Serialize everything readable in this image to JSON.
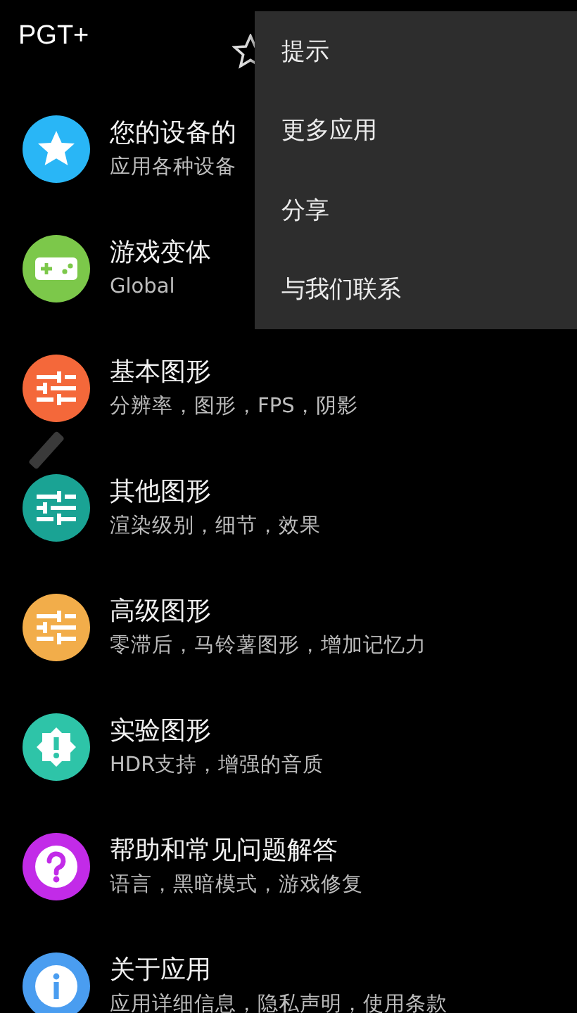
{
  "app_bar": {
    "title": "PGT+"
  },
  "items": [
    {
      "kind": "star",
      "color": "#29b6f6",
      "title": "您的设备的",
      "subtitle": "应用各种设备"
    },
    {
      "kind": "gamepad",
      "color": "#7cc84a",
      "title": "游戏变体",
      "subtitle": "Global"
    },
    {
      "kind": "sliders",
      "color": "#f4683a",
      "title": "基本图形",
      "subtitle": "分辨率，图形，FPS，阴影"
    },
    {
      "kind": "sliders",
      "color": "#1aa394",
      "title": "其他图形",
      "subtitle": "渲染级别，细节，效果"
    },
    {
      "kind": "sliders",
      "color": "#f2ad4a",
      "title": "高级图形",
      "subtitle": "零滞后，马铃薯图形，增加记忆力"
    },
    {
      "kind": "alert",
      "color": "#2ec4a8",
      "title": "实验图形",
      "subtitle": "HDR支持，增强的音质"
    },
    {
      "kind": "help",
      "color": "#c22be8",
      "title": "帮助和常见问题解答",
      "subtitle": "语言，黑暗模式，游戏修复"
    },
    {
      "kind": "info",
      "color": "#4a9df0",
      "title": "关于应用",
      "subtitle": "应用详细信息，隐私声明，使用条款"
    }
  ],
  "overflow_menu": [
    "提示",
    "更多应用",
    "分享",
    "与我们联系"
  ]
}
